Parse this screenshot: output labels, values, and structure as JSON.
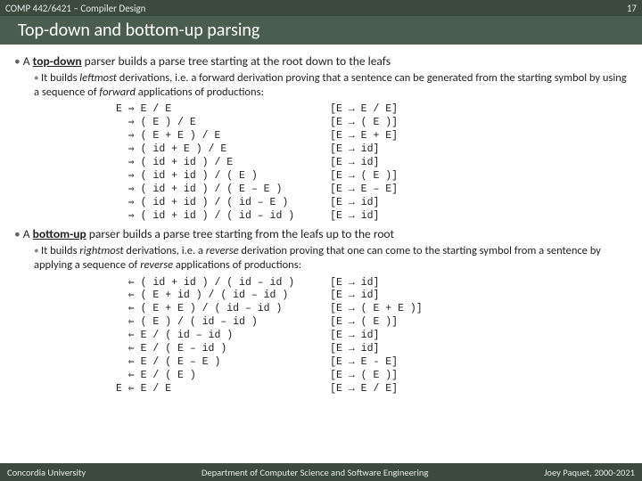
{
  "header": {
    "course": "COMP 442/6421 – Compiler Design",
    "page": "17"
  },
  "title": "Top-down and bottom-up parsing",
  "p1": {
    "lead_a": "A ",
    "lead_b": "top-down",
    "lead_c": " parser builds a parse tree starting at the root down to the leafs",
    "sub_a": "It builds ",
    "sub_b": "leftmost",
    "sub_c": " derivations, i.e. a forward derivation proving that a sentence can be generated from the starting symbol by using a sequence of ",
    "sub_d": "forward",
    "sub_e": " applications of productions:"
  },
  "d1_left": "E ⇒ E / E\n  ⇒ ( E ) / E\n  ⇒ ( E + E ) / E\n  ⇒ ( id + E ) / E\n  ⇒ ( id + id ) / E\n  ⇒ ( id + id ) / ( E )\n  ⇒ ( id + id ) / ( E – E )\n  ⇒ ( id + id ) / ( id – E )\n  ⇒ ( id + id ) / ( id – id )",
  "d1_right": "[E → E / E]\n[E → ( E )]\n[E → E + E]\n[E → id]\n[E → id]\n[E → ( E )]\n[E → E – E]\n[E → id]\n[E → id]",
  "p2": {
    "lead_a": "A ",
    "lead_b": "bottom-up",
    "lead_c": " parser builds a parse tree starting from the leafs up to the root",
    "sub_a": "It builds ",
    "sub_b": "rightmost",
    "sub_c": " derivations, i.e. a ",
    "sub_d": "reverse",
    "sub_e": " derivation proving that one can come to the starting symbol from a sentence by applying a sequence of ",
    "sub_f": "reverse",
    "sub_g": " applications of productions:"
  },
  "d2_left": "  ⇐ ( id + id ) / ( id – id )\n  ⇐ ( E + id ) / ( id – id )\n  ⇐ ( E + E ) / ( id – id )\n  ⇐ ( E ) / ( id – id )\n  ⇐ E / ( id – id )\n  ⇐ E / ( E – id )\n  ⇐ E / ( E – E )\n  ⇐ E / ( E )\nE ⇐ E / E",
  "d2_right": "[E → id]\n[E → id]\n[E → ( E + E )]\n[E → ( E )]\n[E → id]\n[E → id]\n[E → E - E]\n[E → ( E )]\n[E → E / E]",
  "footer": {
    "left": "Concordia University",
    "mid": "Department of Computer Science and Software Engineering",
    "right": "Joey Paquet, 2000-2021"
  }
}
